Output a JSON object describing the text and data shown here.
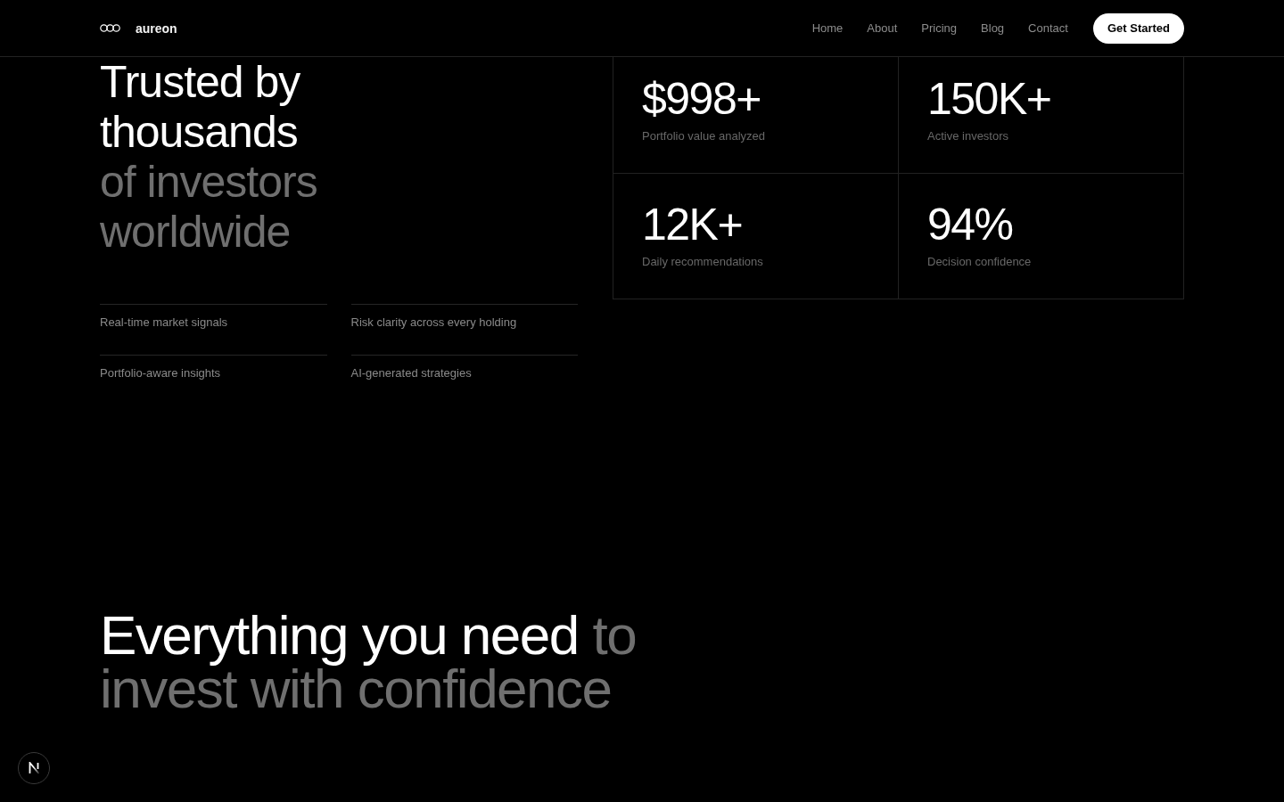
{
  "header": {
    "brand": "aureon",
    "nav": [
      "Home",
      "About",
      "Pricing",
      "Blog",
      "Contact"
    ],
    "cta": "Get Started"
  },
  "trust": {
    "heading": {
      "lead": "Trusted by thousands",
      "trail": "of investors worldwide"
    },
    "features": [
      "Real-time market signals",
      "Risk clarity across every holding",
      "Portfolio-aware insights",
      "AI-generated strategies"
    ],
    "stats": [
      {
        "value": "$998+",
        "label": "Portfolio value analyzed"
      },
      {
        "value": "150K+",
        "label": "Active investors"
      },
      {
        "value": "12K+",
        "label": "Daily recommendations"
      },
      {
        "value": "94%",
        "label": "Decision confidence"
      }
    ]
  },
  "features_intro": {
    "heading": {
      "lead": "Everything you need",
      "trail": "to invest with confidence"
    }
  }
}
